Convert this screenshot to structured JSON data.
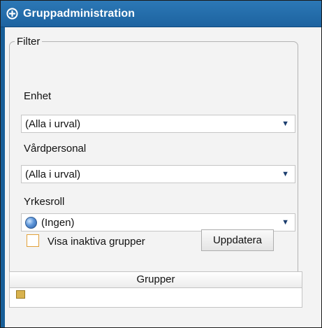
{
  "window": {
    "title": "Gruppadministration"
  },
  "filter": {
    "legend": "Filter",
    "enhet": {
      "label": "Enhet",
      "value": "(Alla i urval)"
    },
    "vardpersonal": {
      "label": "Vårdpersonal",
      "value": "(Alla i urval)"
    },
    "yrkesroll": {
      "label": "Yrkesroll",
      "value": "(Ingen)"
    },
    "show_inactive": {
      "label": "Visa inaktiva grupper",
      "checked": false
    },
    "update_button": "Uppdatera"
  },
  "groups": {
    "header": "Grupper"
  },
  "icons": {
    "title": "plus-circle-icon",
    "dropdown": "chevron-down-icon",
    "role": "globe-icon",
    "row": "folder-icon"
  },
  "colors": {
    "titlebar": "#1d63a0",
    "checkbox_border": "#e2a13a"
  }
}
